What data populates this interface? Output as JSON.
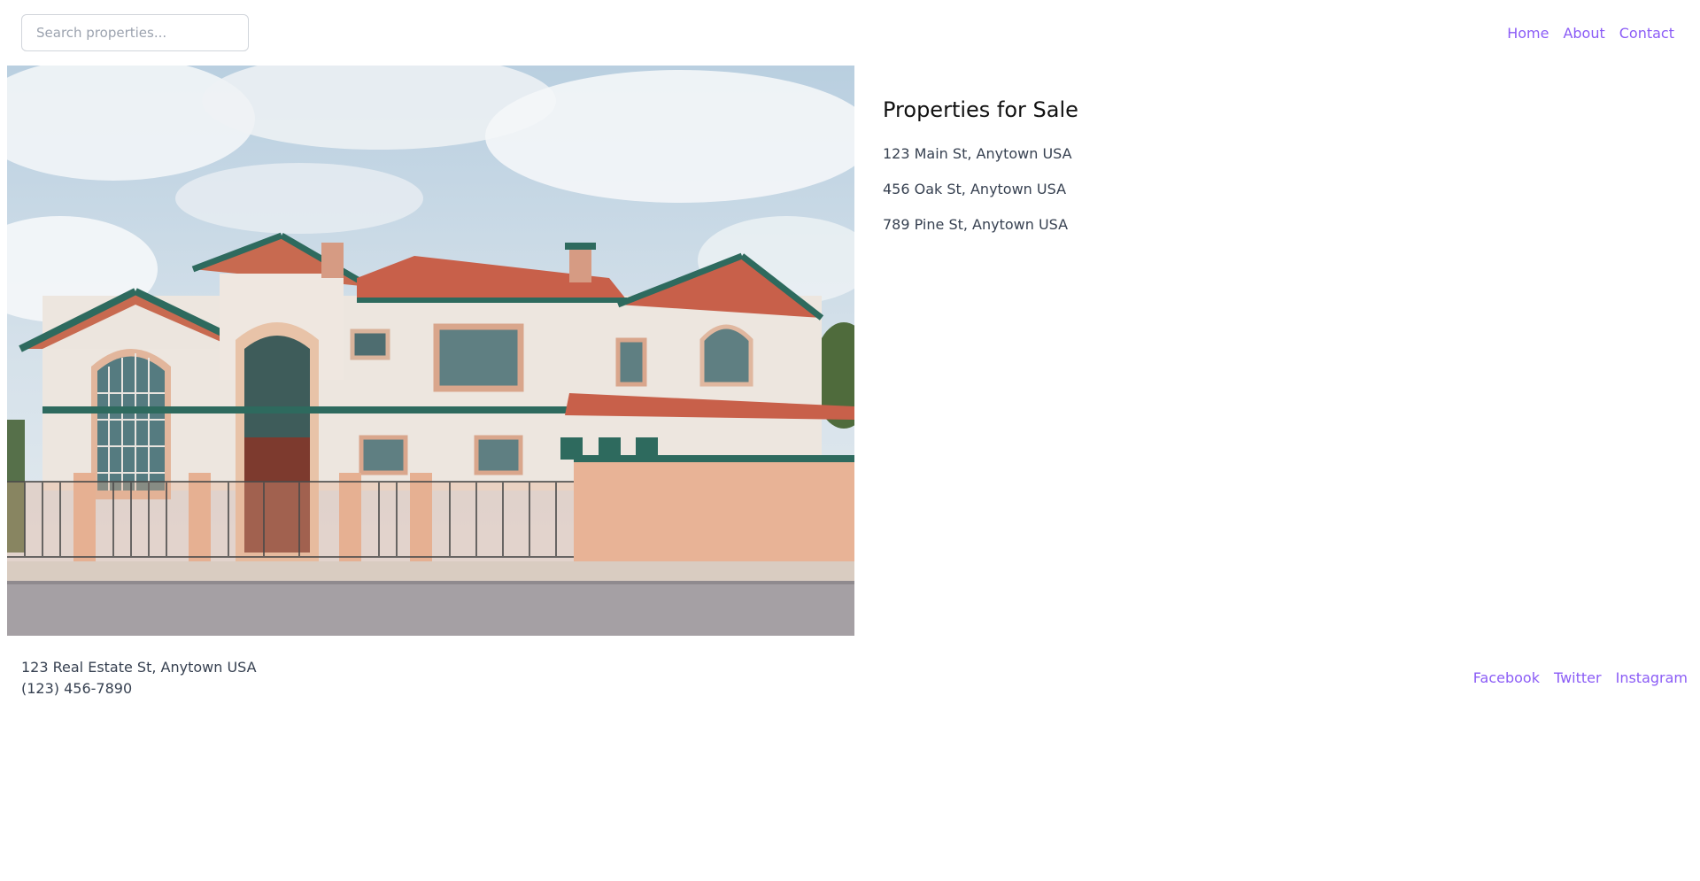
{
  "header": {
    "search": {
      "placeholder": "Search properties...",
      "value": ""
    },
    "nav": [
      "Home",
      "About",
      "Contact"
    ]
  },
  "hero": {
    "image": "house-photo"
  },
  "listings": {
    "title": "Properties for Sale",
    "properties": [
      "123 Main St, Anytown USA",
      "456 Oak St, Anytown USA",
      "789 Pine St, Anytown USA"
    ]
  },
  "footer": {
    "address": "123 Real Estate St, Anytown USA",
    "phone": "(123) 456-7890",
    "social": [
      "Facebook",
      "Twitter",
      "Instagram"
    ]
  },
  "colors": {
    "link": "#8b5cf6",
    "text": "#374151",
    "heading": "#111111"
  }
}
